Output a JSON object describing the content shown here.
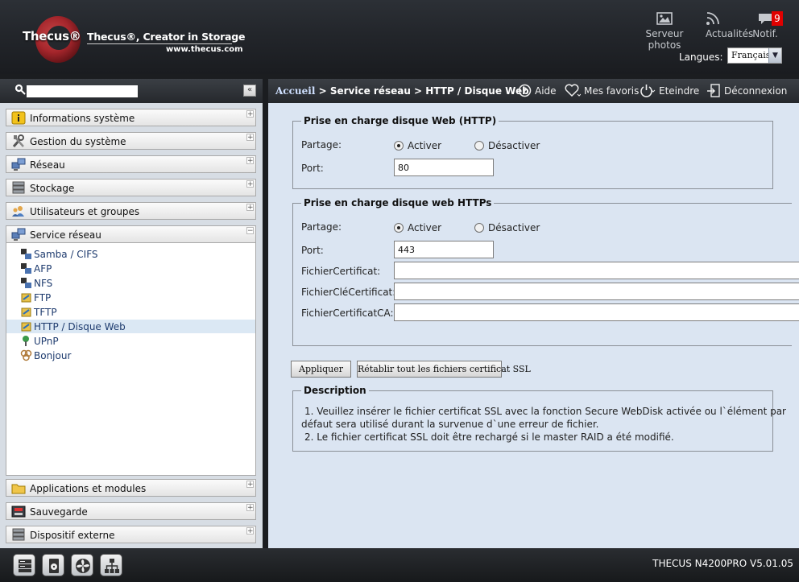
{
  "header": {
    "logo_brand": "Thecus®",
    "slogan": "Thecus®, Creator in Storage",
    "url": "www.thecus.com",
    "photo_label": "Serveur photos",
    "news_label": "Actualités",
    "notif_label": "Notif.",
    "notif_count": "9",
    "language_label": "Langues:",
    "language_value": "Français"
  },
  "sidebar": {
    "collapse_label": "«",
    "menu_top": [
      {
        "label": "Informations système",
        "toggle": "+"
      },
      {
        "label": "Gestion du système",
        "toggle": "+"
      },
      {
        "label": "Réseau",
        "toggle": "+"
      },
      {
        "label": "Stockage",
        "toggle": "+"
      },
      {
        "label": "Utilisateurs et groupes",
        "toggle": "+"
      },
      {
        "label": "Service réseau",
        "toggle": "−"
      }
    ],
    "submenu": [
      {
        "label": "Samba / CIFS"
      },
      {
        "label": "AFP"
      },
      {
        "label": "NFS"
      },
      {
        "label": "FTP"
      },
      {
        "label": "TFTP"
      },
      {
        "label": "HTTP / Disque Web",
        "active": true
      },
      {
        "label": "UPnP"
      },
      {
        "label": "Bonjour"
      }
    ],
    "menu_bottom": [
      {
        "label": "Applications et modules",
        "toggle": "+"
      },
      {
        "label": "Sauvegarde",
        "toggle": "+"
      },
      {
        "label": "Dispositif externe",
        "toggle": "+"
      }
    ]
  },
  "breadcrumb": {
    "home": "Accueil",
    "path": " > Service réseau > HTTP / Disque Web",
    "help": "Aide",
    "favorites": "Mes favoris",
    "shutdown": "Eteindre",
    "logout": "Déconnexion"
  },
  "http_section": {
    "legend": "Prise en charge disque Web (HTTP)",
    "share_label": "Partage:",
    "enable_label": "Activer",
    "disable_label": "Désactiver",
    "enabled": true,
    "port_label": "Port:",
    "port_value": "80"
  },
  "https_section": {
    "legend": "Prise en charge disque web HTTPs",
    "share_label": "Partage:",
    "enable_label": "Activer",
    "disable_label": "Désactiver",
    "enabled": true,
    "port_label": "Port:",
    "port_value": "443",
    "cert_label": "FichierCertificat:",
    "key_label": "FichierCléCertificat:",
    "ca_label": "FichierCertificatCA:"
  },
  "buttons": {
    "apply": "Appliquer",
    "restore": "Rétablir tout les fichiers certificat SSL"
  },
  "description": {
    "legend": "Description",
    "line1": "1. Veuillez insérer le fichier certificat SSL avec la fonction Secure WebDisk activée ou l`élément par",
    "line2": "défaut sera utilisé durant la survenue d`une erreur de fichier.",
    "line3": "2. Le fichier certificat SSL doit être rechargé si le master RAID a été modifié."
  },
  "footer": {
    "model": "THECUS N4200PRO V5.01.05"
  }
}
